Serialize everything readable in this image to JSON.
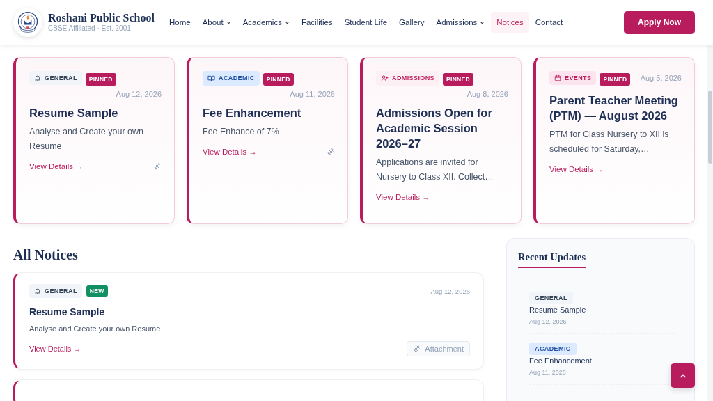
{
  "header": {
    "school_name": "Roshani Public School",
    "tagline": "CBSE Affiliated · Est. 2001",
    "nav": [
      {
        "label": "Home",
        "dropdown": false,
        "selected": false
      },
      {
        "label": "About",
        "dropdown": true,
        "selected": false
      },
      {
        "label": "Academics",
        "dropdown": true,
        "selected": false
      },
      {
        "label": "Facilities",
        "dropdown": false,
        "selected": false
      },
      {
        "label": "Student Life",
        "dropdown": false,
        "selected": false
      },
      {
        "label": "Gallery",
        "dropdown": false,
        "selected": false
      },
      {
        "label": "Admissions",
        "dropdown": true,
        "selected": false
      },
      {
        "label": "Notices",
        "dropdown": false,
        "selected": true
      },
      {
        "label": "Contact",
        "dropdown": false,
        "selected": false
      }
    ],
    "cta": "Apply Now"
  },
  "pinned_notices": [
    {
      "category": {
        "kind": "general",
        "label": "GENERAL"
      },
      "badge": "PINNED",
      "date": "Aug 12, 2026",
      "title": "Resume Sample",
      "summary": "Analyse and Create your own Resume",
      "link": "View Details →",
      "attachment": true
    },
    {
      "category": {
        "kind": "academic",
        "label": "ACADEMIC"
      },
      "badge": "PINNED",
      "date": "Aug 11, 2026",
      "title": "Fee Enhancement",
      "summary": "Fee Enhance of 7%",
      "link": "View Details →",
      "attachment": true
    },
    {
      "category": {
        "kind": "admissions",
        "label": "ADMISSIONS"
      },
      "badge": "PINNED",
      "date": "Aug 8, 2026",
      "title": "Admissions Open for Academic Session 2026–27",
      "summary": "Applications are invited for Nursery to Class XII. Collect…",
      "link": "View Details →",
      "attachment": false
    },
    {
      "category": {
        "kind": "events",
        "label": "EVENTS"
      },
      "badge": "PINNED",
      "date": "Aug 5, 2026",
      "title": "Parent Teacher Meeting (PTM) — August 2026",
      "summary": "PTM for Class Nursery to XII is scheduled for Saturday,…",
      "link": "View Details →",
      "attachment": false
    }
  ],
  "all_notices": {
    "heading": "All Notices",
    "items": [
      {
        "category": {
          "kind": "general",
          "label": "GENERAL"
        },
        "badge": "NEW",
        "date": "Aug 12, 2026",
        "title": "Resume Sample",
        "summary": "Analyse and Create your own Resume",
        "link": "View Details →",
        "attachment": "Attachment"
      }
    ]
  },
  "recent_updates": {
    "heading": "Recent Updates",
    "items": [
      {
        "category": {
          "kind": "general",
          "label": "GENERAL"
        },
        "title": "Resume Sample",
        "date": "Aug 12, 2026"
      },
      {
        "category": {
          "kind": "academic",
          "label": "ACADEMIC"
        },
        "title": "Fee Enhancement",
        "date": "Aug 11, 2026"
      }
    ]
  }
}
